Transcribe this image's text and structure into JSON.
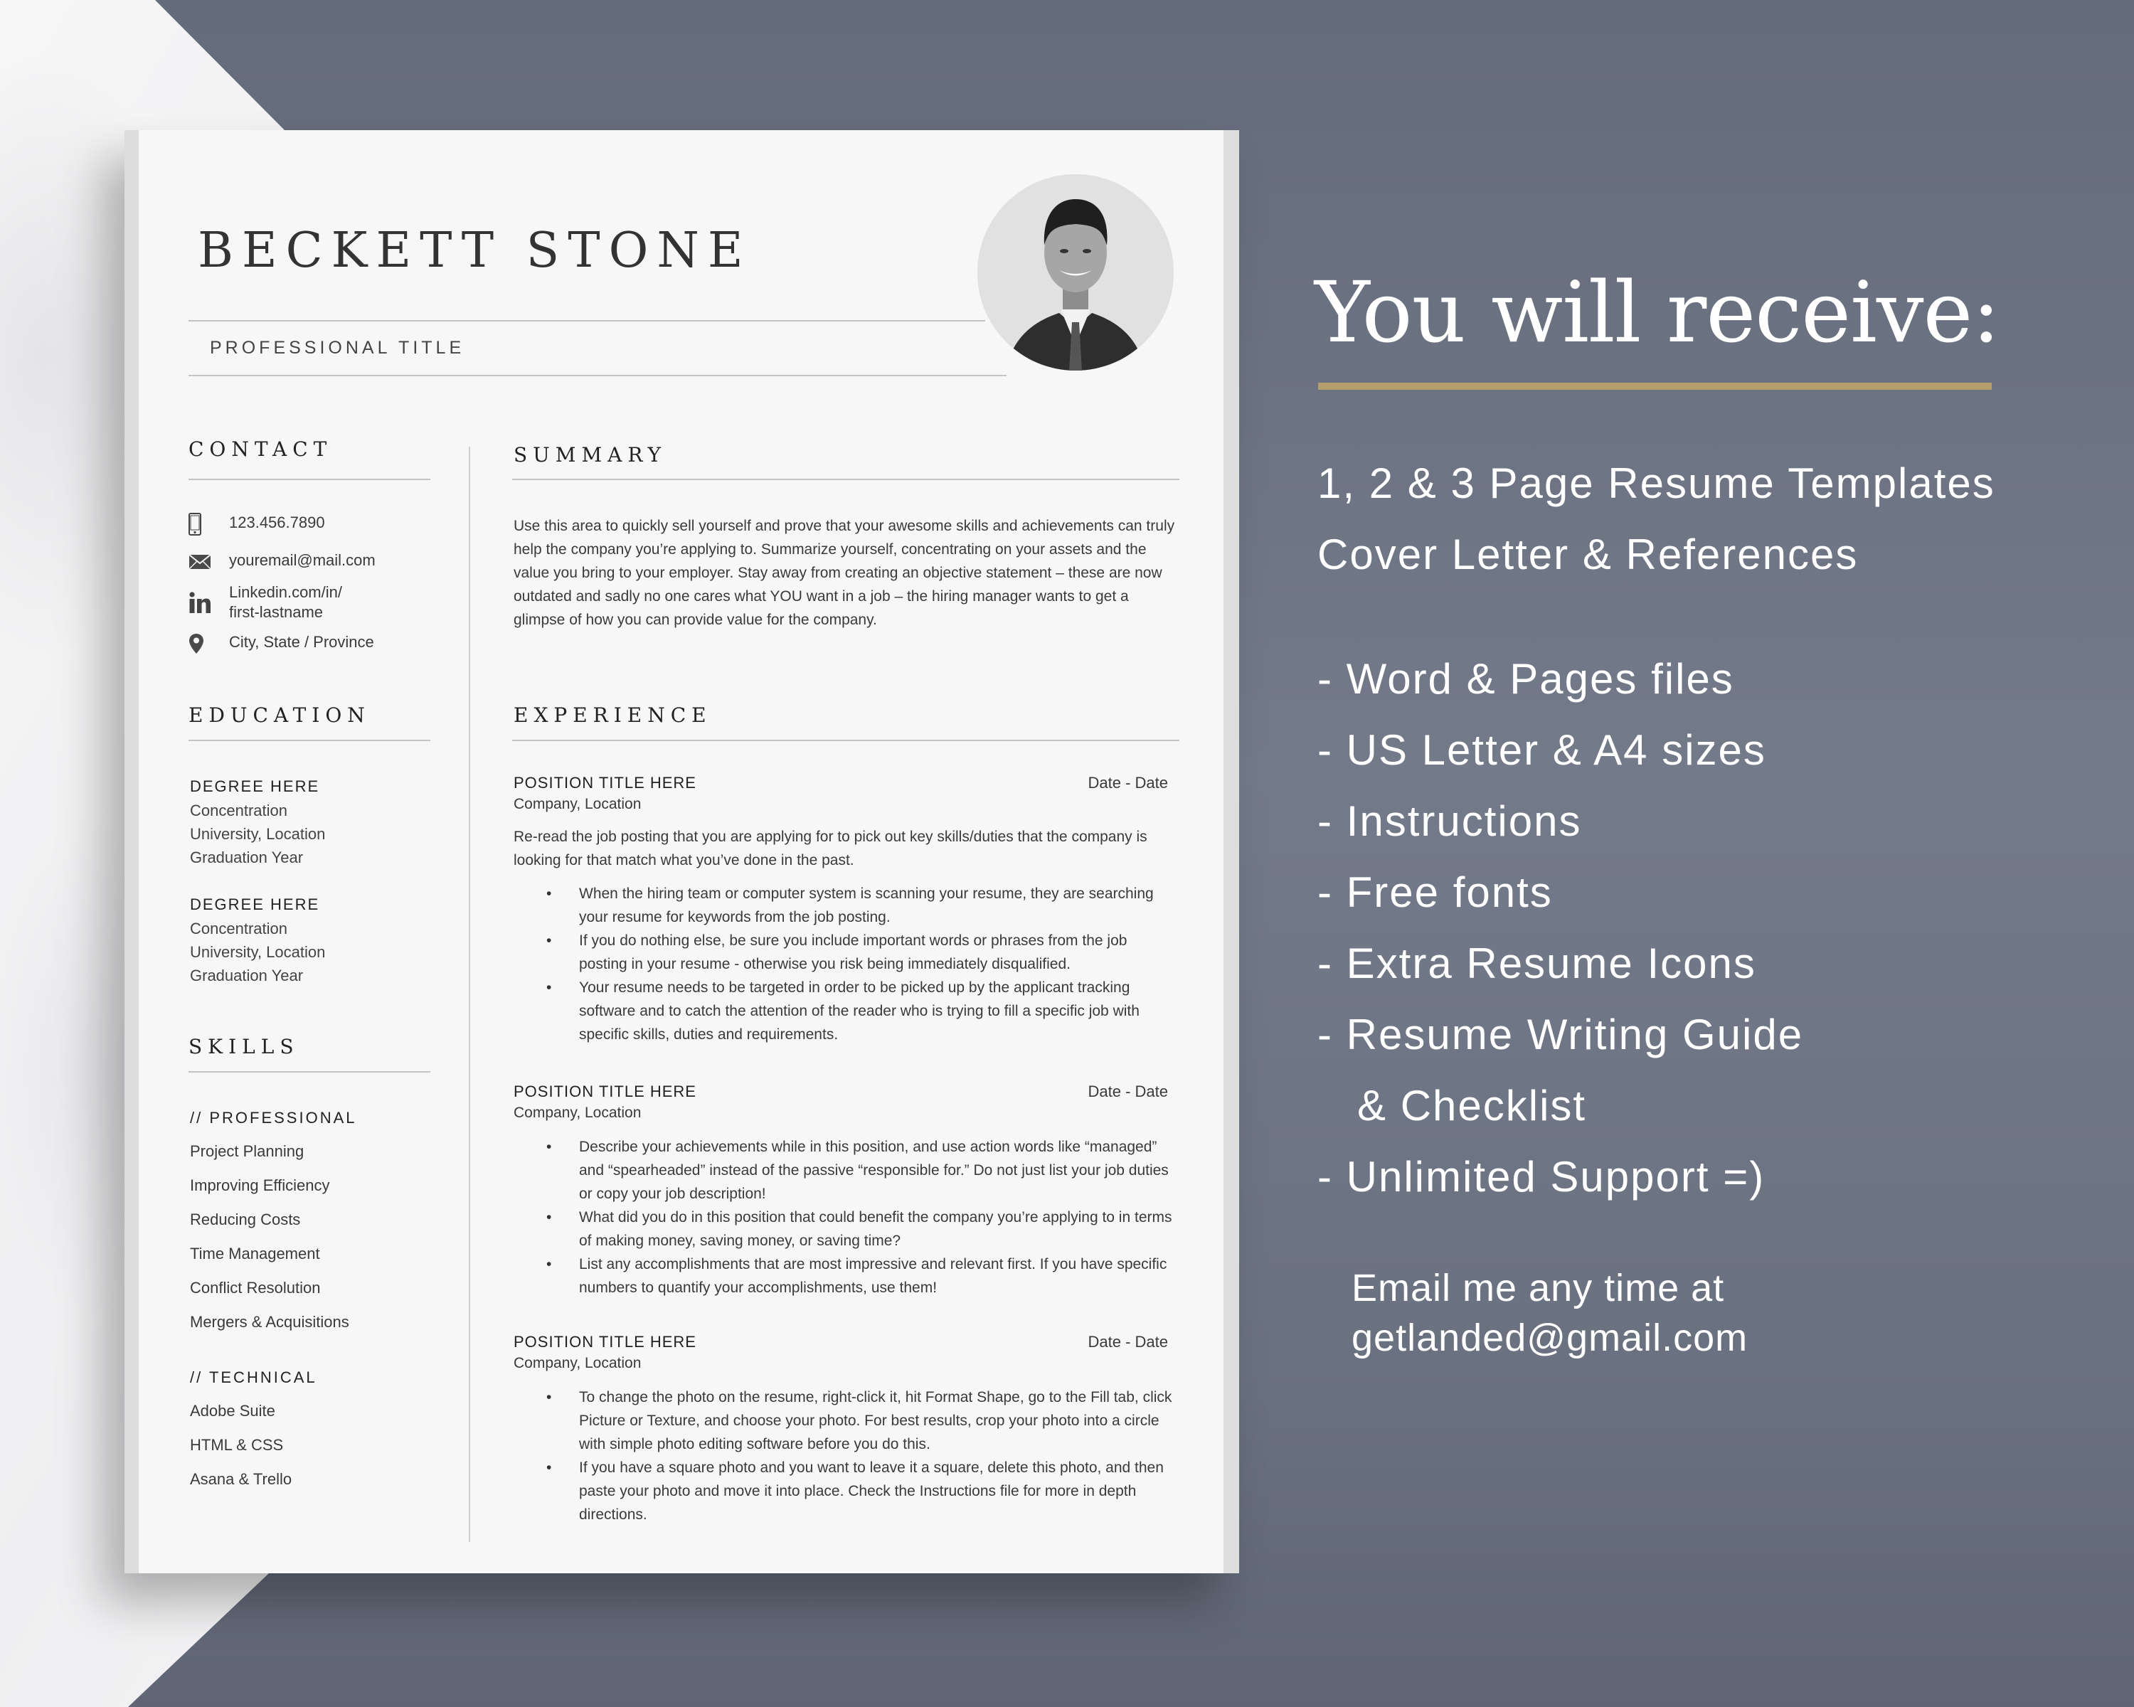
{
  "resume": {
    "name": "BECKETT STONE",
    "professional_title": "PROFESSIONAL TITLE",
    "contact": {
      "heading": "CONTACT",
      "phone": {
        "icon": "phone-icon",
        "text": "123.456.7890"
      },
      "email": {
        "icon": "envelope-icon",
        "text": "youremail@mail.com"
      },
      "linkedin": {
        "icon": "linkedin-icon",
        "line1": "Linkedin.com/in/",
        "line2": "first-lastname"
      },
      "location": {
        "icon": "map-pin-icon",
        "text": "City, State / Province"
      }
    },
    "education": {
      "heading": "EDUCATION",
      "entries": [
        {
          "degree": "DEGREE HERE",
          "concentration": "Concentration",
          "university": "University, Location",
          "year": "Graduation Year"
        },
        {
          "degree": "DEGREE HERE",
          "concentration": "Concentration",
          "university": "University, Location",
          "year": "Graduation Year"
        }
      ]
    },
    "skills": {
      "heading": "SKILLS",
      "professional_heading": "// PROFESSIONAL",
      "professional": [
        "Project Planning",
        "Improving Efficiency",
        "Reducing Costs",
        "Time Management",
        "Conflict Resolution",
        "Mergers & Acquisitions"
      ],
      "technical_heading": "// TECHNICAL",
      "technical": [
        "Adobe Suite",
        "HTML & CSS",
        "Asana & Trello"
      ]
    },
    "summary": {
      "heading": "SUMMARY",
      "text": "Use this area to quickly sell yourself and prove that your awesome skills and achievements can truly help the company you’re applying to.  Summarize yourself, concentrating on your assets and the value you bring to your employer.  Stay away from creating an objective statement – these are now outdated and sadly no one cares what YOU want in a job – the hiring manager wants to get a glimpse of how you can provide value for the company."
    },
    "experience": {
      "heading": "EXPERIENCE",
      "jobs": [
        {
          "title": "POSITION TITLE HERE",
          "dates": "Date - Date",
          "company": "Company, Location",
          "description": "Re-read the job posting that you are applying for to pick out key skills/duties that the company is looking for that match what you’ve done in the past.",
          "bullets": [
            "When the hiring team or computer system is scanning your resume, they are searching your resume for keywords from the job posting.",
            "If you do nothing else, be sure you include important words or phrases from the job posting in your resume - otherwise you risk being immediately disqualified.",
            "Your resume needs to be targeted in order to be picked up by the applicant tracking software and to catch the attention of the reader who is trying to fill a specific job with specific skills, duties and requirements."
          ]
        },
        {
          "title": "POSITION TITLE HERE",
          "dates": "Date - Date",
          "company": "Company, Location",
          "bullets": [
            "Describe your achievements while in this position, and use action words like “managed” and “spearheaded” instead of the passive “responsible for.” Do not just list your job duties or copy your job description!",
            "What did you do in this position that could benefit the company you’re applying to in terms of making money, saving money, or saving time?",
            "List any accomplishments that are most impressive and relevant first.  If you have specific numbers to quantify your accomplishments, use them!"
          ]
        },
        {
          "title": "POSITION TITLE HERE",
          "dates": "Date - Date",
          "company": "Company, Location",
          "bullets": [
            "To change the photo on the resume, right-click it, hit Format Shape, go to the Fill tab, click Picture or Texture, and choose your photo. For best results, crop your photo into a circle with simple photo editing software before you do this.",
            "If you have a square photo and you want to leave it a square, delete this photo, and then paste your photo and move it into place. Check the Instructions file for more in depth directions."
          ]
        }
      ]
    }
  },
  "promo": {
    "title": "You will receive:",
    "accent_color": "#b59e6b",
    "background_color": "#727a88",
    "headline_items": [
      "1, 2 & 3 Page Resume Templates",
      "Cover Letter & References"
    ],
    "features": [
      "- Word & Pages files",
      "- US Letter & A4 sizes",
      "- Instructions",
      "- Free fonts",
      "- Extra Resume Icons",
      "- Resume Writing Guide",
      "   & Checklist",
      "- Unlimited Support =)"
    ],
    "email_line1": "Email me any time at",
    "email_line2": "getlanded@gmail.com"
  }
}
